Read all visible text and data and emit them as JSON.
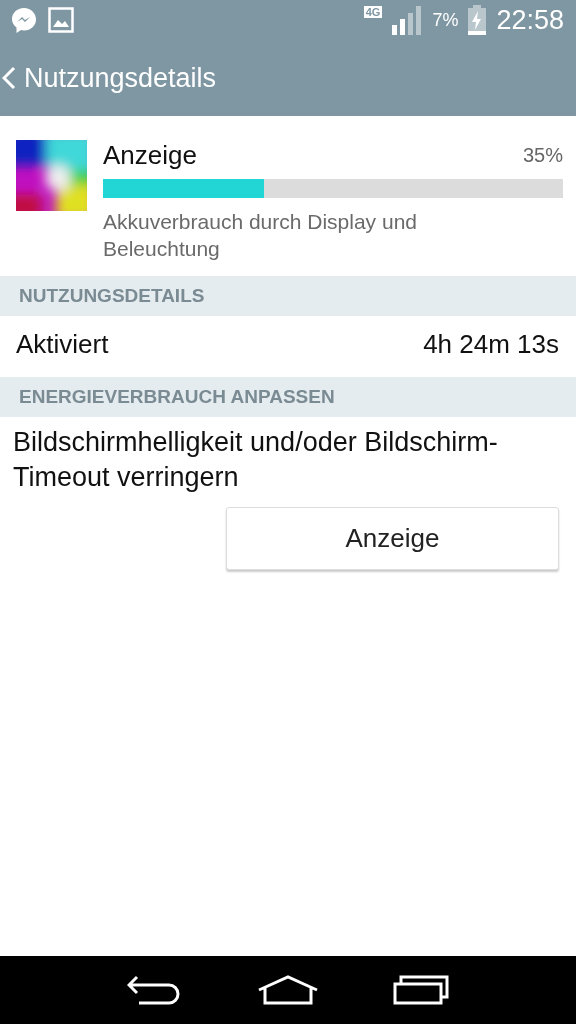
{
  "status_bar": {
    "network": "4G",
    "battery_percent": "7%",
    "time": "22:58"
  },
  "header": {
    "title": "Nutzungsdetails"
  },
  "app_usage": {
    "name": "Anzeige",
    "percent": "35%",
    "level": 0.35,
    "description": "Akkuverbrauch durch Display und Beleuchtung"
  },
  "sections": [
    {
      "heading": "NUTZUNGSDETAILS",
      "kind": "stat",
      "label": "Aktiviert",
      "value": "4h 24m 13s"
    },
    {
      "heading": "ENERGIEVERBRAUCH ANPASSEN",
      "kind": "action",
      "text": "Bildschirmhelligkeit und/oder Bildschirm-Timeout verringern",
      "button": "Anzeige"
    }
  ]
}
